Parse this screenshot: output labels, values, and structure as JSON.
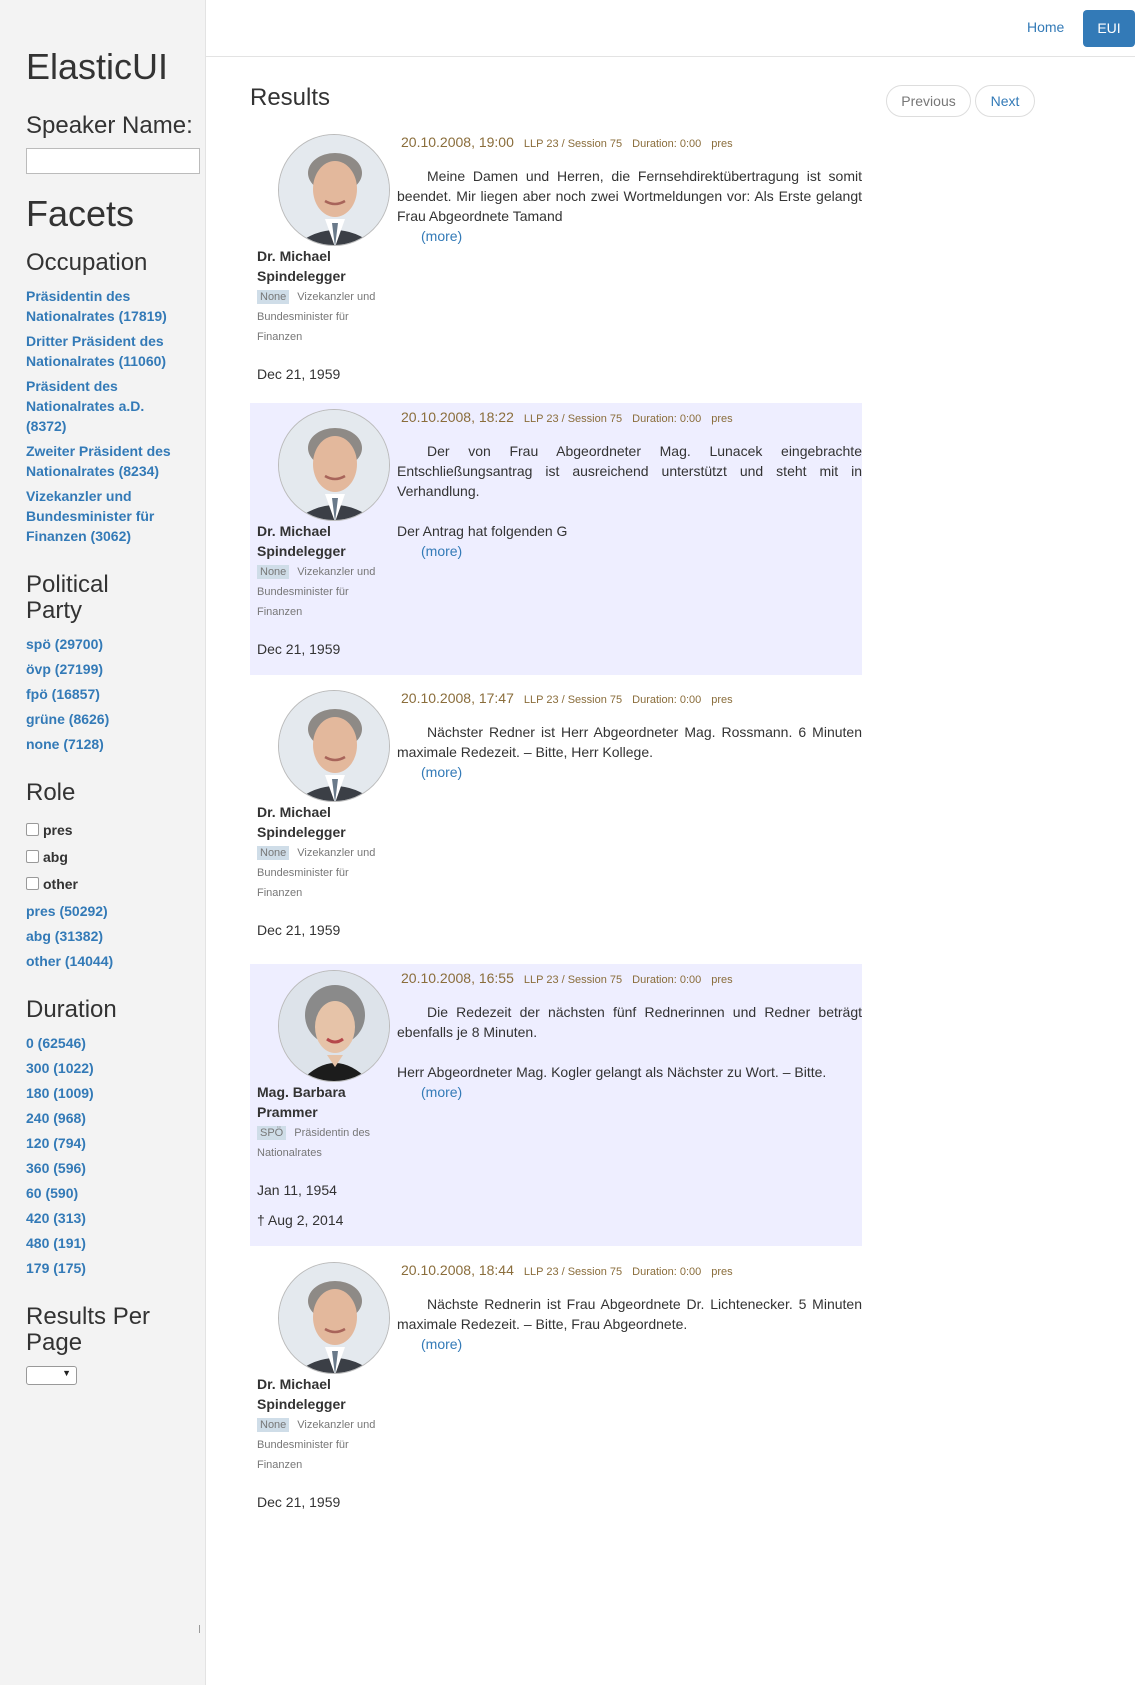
{
  "app_title": "ElasticUI",
  "sidebar": {
    "speaker_label": "Speaker Name:",
    "speaker_value": "",
    "facets_title": "Facets",
    "occupation": {
      "heading": "Occupation",
      "items": [
        "Präsidentin des Nationalrates (17819)",
        "Dritter Präsident des Nationalrates (11060)",
        "Präsident des Nationalrates a.D. (8372)",
        "Zweiter Präsident des Nationalrates (8234)",
        "Vizekanzler und Bundesminister für Finanzen (3062)"
      ]
    },
    "party": {
      "heading": "Political Party",
      "items": [
        "spö (29700)",
        "övp (27199)",
        "fpö (16857)",
        "grüne (8626)",
        "none (7128)"
      ]
    },
    "role": {
      "heading": "Role",
      "checkboxes": [
        "pres",
        "abg",
        "other"
      ],
      "items": [
        "pres (50292)",
        "abg (31382)",
        "other (14044)"
      ]
    },
    "duration": {
      "heading": "Duration",
      "items": [
        "0 (62546)",
        "300 (1022)",
        "180 (1009)",
        "240 (968)",
        "120 (794)",
        "360 (596)",
        "60 (590)",
        "420 (313)",
        "480 (191)",
        "179 (175)"
      ]
    },
    "results_per_page": {
      "heading": "Results Per Page",
      "selected": ""
    }
  },
  "nav": {
    "home": "Home",
    "eui": "EUI"
  },
  "main": {
    "title": "Results",
    "previous": "Previous",
    "next": "Next",
    "more_label": "(more)",
    "results": [
      {
        "date": "20.10.2008, 19:00",
        "session": "LLP 23 / Session 75",
        "duration": "Duration: 0:00",
        "role": "pres",
        "paragraphs": [
          "Meine Damen und Herren, die Fernsehdirektübertragung ist somit beendet. Mir liegen aber noch zwei Wortmeldungen vor: Als Erste gelangt Frau Abgeordnete Tamand"
        ],
        "name": "Dr. Michael Spindelegger",
        "party": "None",
        "occupation": "Vizekanzler und Bundesminister für Finanzen",
        "birth": "Dec 21, 1959",
        "death": ""
      },
      {
        "date": "20.10.2008, 18:22",
        "session": "LLP 23 / Session 75",
        "duration": "Duration: 0:00",
        "role": "pres",
        "paragraphs": [
          "Der von Frau Abgeordneter Mag. Lunacek eingebrachte Entschließungsantrag ist ausreichend unterstützt und steht mit in Verhandlung.",
          "Der Antrag hat folgenden G"
        ],
        "name": "Dr. Michael Spindelegger",
        "party": "None",
        "occupation": "Vizekanzler und Bundesminister für Finanzen",
        "birth": "Dec 21, 1959",
        "death": ""
      },
      {
        "date": "20.10.2008, 17:47",
        "session": "LLP 23 / Session 75",
        "duration": "Duration: 0:00",
        "role": "pres",
        "paragraphs": [
          "Nächster Redner ist Herr Abgeordneter Mag. Rossmann. 6 Minuten maximale Redezeit. – Bitte, Herr Kollege."
        ],
        "name": "Dr. Michael Spindelegger",
        "party": "None",
        "occupation": "Vizekanzler und Bundesminister für Finanzen",
        "birth": "Dec 21, 1959",
        "death": ""
      },
      {
        "date": "20.10.2008, 16:55",
        "session": "LLP 23 / Session 75",
        "duration": "Duration: 0:00",
        "role": "pres",
        "paragraphs": [
          "Die Redezeit der nächsten fünf Rednerinnen und Redner beträgt ebenfalls je 8 Minuten.",
          "Herr Abgeordneter Mag. Kogler gelangt als Nächster zu Wort. – Bitte."
        ],
        "name": "Mag. Barbara Prammer",
        "party": "SPÖ",
        "occupation": "Präsidentin des Nationalrates",
        "birth": "Jan 11, 1954",
        "death": "† Aug 2, 2014"
      },
      {
        "date": "20.10.2008, 18:44",
        "session": "LLP 23 / Session 75",
        "duration": "Duration: 0:00",
        "role": "pres",
        "paragraphs": [
          "Nächste Rednerin ist Frau Abgeordnete Dr. Lichtenecker. 5 Minuten maximale Redezeit. – Bitte, Frau Abgeordnete."
        ],
        "name": "Dr. Michael Spindelegger",
        "party": "None",
        "occupation": "Vizekanzler und Bundesminister für Finanzen",
        "birth": "Dec 21, 1959",
        "death": ""
      }
    ]
  }
}
